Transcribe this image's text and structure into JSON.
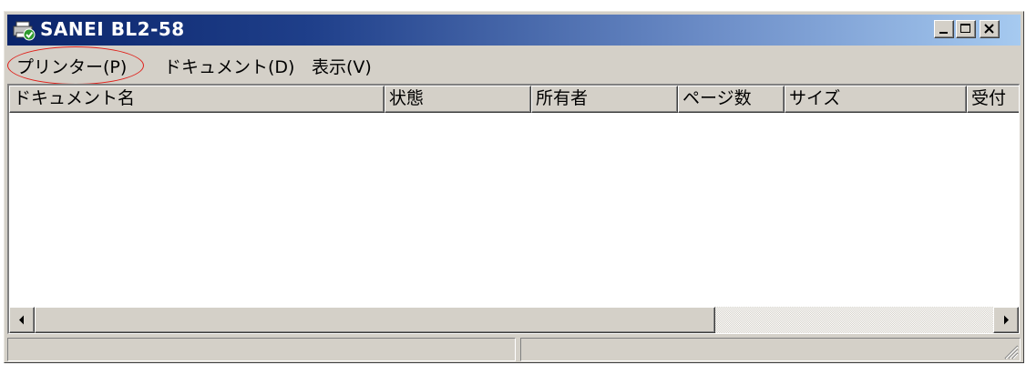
{
  "window": {
    "title": "SANEI BL2-58",
    "icon": "printer-icon"
  },
  "title_buttons": {
    "minimize": "minimize-icon",
    "maximize": "maximize-icon",
    "close": "close-icon"
  },
  "menu": {
    "items": [
      {
        "label": "プリンター(P)"
      },
      {
        "label": "ドキュメント(D)"
      },
      {
        "label": "表示(V)"
      }
    ],
    "highlight_color": "#e0201a"
  },
  "list": {
    "columns": [
      {
        "label": "ドキュメント名"
      },
      {
        "label": "状態"
      },
      {
        "label": "所有者"
      },
      {
        "label": "ページ数"
      },
      {
        "label": "サイズ"
      },
      {
        "label": "受付"
      }
    ],
    "rows": []
  },
  "scrollbar": {
    "left_icon": "arrow-left-icon",
    "right_icon": "arrow-right-icon"
  },
  "statusbar": {
    "pane1": "",
    "pane2": ""
  },
  "colors": {
    "titlebar_start": "#0a246a",
    "titlebar_end": "#a6caf0",
    "face": "#d4d0c8"
  }
}
